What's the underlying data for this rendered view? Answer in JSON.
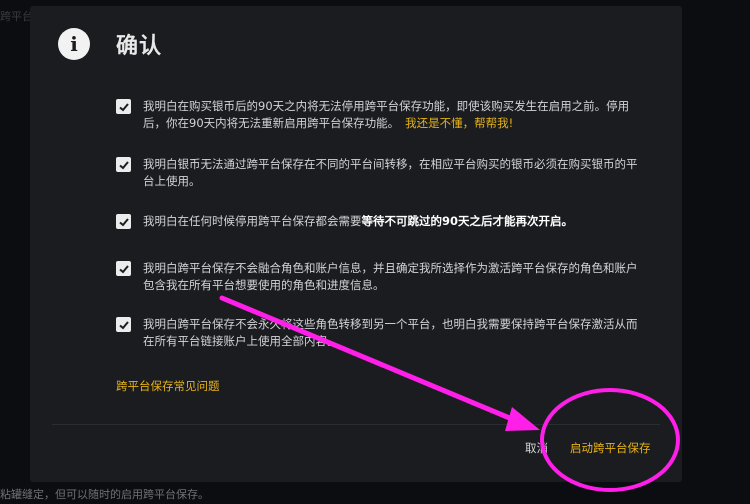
{
  "background": {
    "top_text": "跨平台",
    "bottom_text": "粘罐缝定，但可以随时的启用跨平台保存。"
  },
  "dialog": {
    "title": "确认",
    "icon": "info-icon",
    "items": [
      {
        "checked": true,
        "text": "我明白在购买银币后的90天之内将无法停用跨平台保存功能，即使该购买发生在启用之前。停用后，你在90天内将无法重新启用跨平台保存功能。",
        "link": "我还是不懂，帮帮我!"
      },
      {
        "checked": true,
        "text": "我明白银币无法通过跨平台保存在不同的平台间转移，在相应平台购买的银币必须在购买银币的平台上使用。"
      },
      {
        "checked": true,
        "text_prefix": "我明白在任何时候停用跨平台保存都会需要",
        "text_bold": "等待不可跳过的90天之后才能再次开启。"
      },
      {
        "checked": true,
        "text": "我明白跨平台保存不会融合角色和账户信息，并且确定我所选择作为激活跨平台保存的角色和账户包含我在所有平台想要使用的角色和进度信息。"
      },
      {
        "checked": true,
        "text": "我明白跨平台保存不会永久将这些角色转移到另一个平台，也明白我需要保持跨平台保存激活从而在所有平台链接账户上使用全部内容。"
      }
    ],
    "faq_link": "跨平台保存常见问题",
    "cancel_label": "取消",
    "enable_label": "启动跨平台保存"
  },
  "colors": {
    "dialog_bg": "#1b1c20",
    "accent": "#e6b318",
    "annotation": "#ff1fe8"
  }
}
